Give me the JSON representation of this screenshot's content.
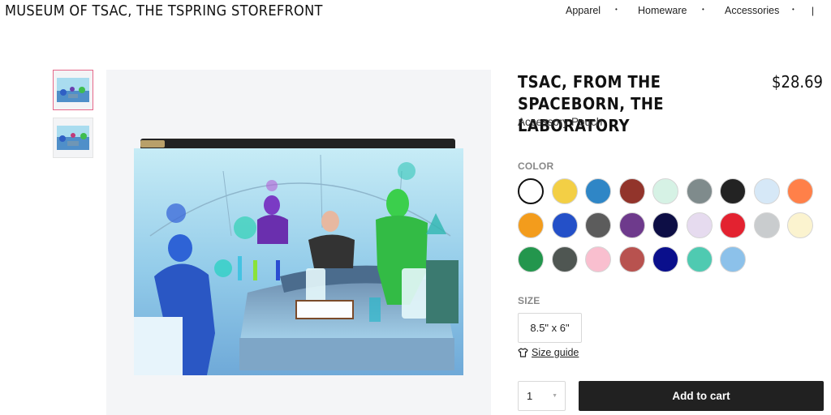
{
  "store": {
    "title": "MUSEUM OF TSAC, THE TSPRING STOREFRONT"
  },
  "nav": {
    "items": [
      {
        "label": "Apparel",
        "caret": "•"
      },
      {
        "label": "Homeware",
        "caret": "•"
      },
      {
        "label": "Accessories",
        "caret": "•"
      }
    ],
    "separator": "|"
  },
  "product": {
    "title": "TSAC, FROM THE SPACEBORN, THE LABORATORY",
    "price": "$28.69",
    "subtitle": "Accessory Pouch"
  },
  "color": {
    "label": "COLOR",
    "selected_index": 0,
    "swatches": [
      "#ffffff",
      "#f3cf45",
      "#2f86c6",
      "#92342b",
      "#d6f2e5",
      "#7f8b8c",
      "#232323",
      "#d6e8f7",
      "#ff8049",
      "#f39c1c",
      "#2450c8",
      "#5c5c5c",
      "#6e3a8c",
      "#0d0e45",
      "#e6dbef",
      "#e32230",
      "#c9ccce",
      "#fbf3cf",
      "#23964d",
      "#4f5652",
      "#f9bfcf",
      "#b8524f",
      "#0a0f8c",
      "#4fcab1",
      "#8cc1ea"
    ]
  },
  "size": {
    "label": "SIZE",
    "value": "8.5\" x 6\""
  },
  "size_guide": {
    "label": "Size guide",
    "icon": "tshirt-icon"
  },
  "quantity": {
    "value": "1"
  },
  "cart": {
    "label": "Add to cart"
  }
}
